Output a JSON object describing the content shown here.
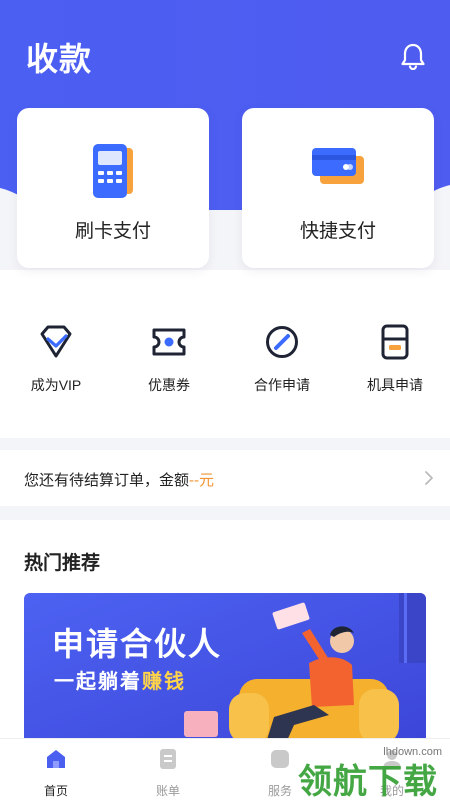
{
  "header": {
    "title": "收款"
  },
  "pay_cards": [
    {
      "label": "刷卡支付",
      "icon": "card-reader-icon"
    },
    {
      "label": "快捷支付",
      "icon": "bank-cards-icon"
    }
  ],
  "quick_actions": [
    {
      "label": "成为VIP",
      "icon": "diamond-vip-icon"
    },
    {
      "label": "优惠券",
      "icon": "coupon-icon"
    },
    {
      "label": "合作申请",
      "icon": "cooperation-icon"
    },
    {
      "label": "机具申请",
      "icon": "device-icon"
    }
  ],
  "notice": {
    "text": "您还有待结算订单，金额",
    "amount": "--元"
  },
  "recommend": {
    "title": "热门推荐",
    "banner_title": "申请合伙人",
    "banner_sub_a": "一起躺着",
    "banner_sub_b": "赚钱"
  },
  "tabbar": [
    {
      "label": "首页",
      "icon": "home-icon",
      "active": true
    },
    {
      "label": "账单",
      "icon": "bill-icon",
      "active": false
    },
    {
      "label": "服务",
      "icon": "service-icon",
      "active": false
    },
    {
      "label": "我的",
      "icon": "profile-icon",
      "active": false
    }
  ],
  "watermark": {
    "site": "lhdown.com",
    "logo": "领航下载"
  },
  "colors": {
    "brand": "#4a5ef0",
    "accent": "#f29433",
    "card_blue": "#3b6bff",
    "card_orange": "#f7a23c"
  }
}
